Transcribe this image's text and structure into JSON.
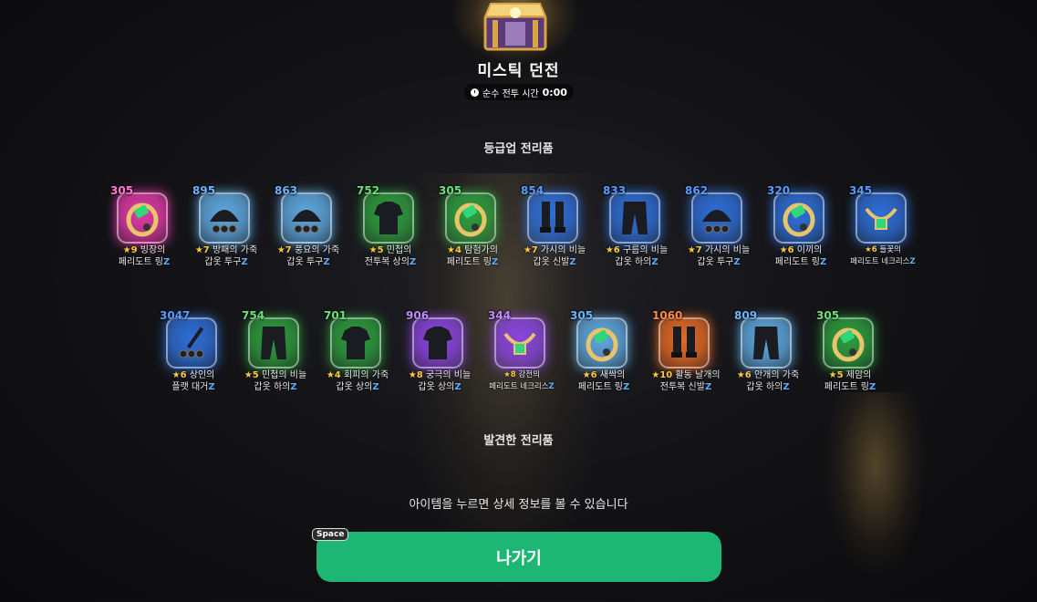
{
  "header": {
    "title": "미스틱 던전",
    "timer_label": "순수 전투 시간",
    "timer_value": "0:00"
  },
  "sections": {
    "upgrade_title": "등급업 전리품",
    "found_title": "발견한 전리품"
  },
  "items": [
    {
      "score": "305",
      "star": "★9",
      "name1": "빙장의",
      "name2": "페리도트 링",
      "icon": "ring-icon",
      "rarity": "pink",
      "z": "Z"
    },
    {
      "score": "895",
      "star": "★7",
      "name1": "방패의 가죽",
      "name2": "갑옷 투구",
      "icon": "helmet-icon",
      "rarity": "lightblue",
      "z": "Z"
    },
    {
      "score": "863",
      "star": "★7",
      "name1": "풍요의 가죽",
      "name2": "갑옷 투구",
      "icon": "helmet-icon",
      "rarity": "lightblue",
      "z": "Z"
    },
    {
      "score": "752",
      "star": "★5",
      "name1": "민첩의",
      "name2": "전투복 상의",
      "icon": "shirt-icon",
      "rarity": "green",
      "z": "Z"
    },
    {
      "score": "305",
      "star": "★4",
      "name1": "탐험가의",
      "name2": "페리도트 링",
      "icon": "ring-icon",
      "rarity": "green",
      "z": "Z"
    },
    {
      "score": "854",
      "star": "★7",
      "name1": "가시의 비늘",
      "name2": "갑옷 신발",
      "icon": "boots-icon",
      "rarity": "blue",
      "z": "Z"
    },
    {
      "score": "833",
      "star": "★6",
      "name1": "구름의 비늘",
      "name2": "갑옷 하의",
      "icon": "pants-icon",
      "rarity": "blue",
      "z": "Z"
    },
    {
      "score": "862",
      "star": "★7",
      "name1": "가시의 비늘",
      "name2": "갑옷 투구",
      "icon": "helmet-icon",
      "rarity": "blue",
      "z": "Z"
    },
    {
      "score": "320",
      "star": "★6",
      "name1": "이끼의",
      "name2": "페리도트 링",
      "icon": "ring-icon",
      "rarity": "blue",
      "z": "Z"
    },
    {
      "score": "345",
      "star": "★6",
      "name1": "들꽃의",
      "name2": "페리도트 네크리스",
      "icon": "necklace-icon",
      "rarity": "blue",
      "z": "Z"
    },
    {
      "score": "3047",
      "star": "★6",
      "name1": "상인의",
      "name2": "플랫 대거",
      "icon": "dagger-icon",
      "rarity": "blue",
      "z": "Z"
    },
    {
      "score": "754",
      "star": "★5",
      "name1": "민첩의 비늘",
      "name2": "갑옷 하의",
      "icon": "pants-icon",
      "rarity": "green",
      "z": "Z"
    },
    {
      "score": "701",
      "star": "★4",
      "name1": "회피의 가죽",
      "name2": "갑옷 상의",
      "icon": "shirt-icon",
      "rarity": "green",
      "z": "Z"
    },
    {
      "score": "906",
      "star": "★8",
      "name1": "궁극의 비늘",
      "name2": "갑옷 상의",
      "icon": "shirt-icon",
      "rarity": "purple",
      "z": "Z"
    },
    {
      "score": "344",
      "star": "★8",
      "name1": "강전의",
      "name2": "페리도트 네크리스",
      "icon": "necklace-icon",
      "rarity": "purple",
      "z": "Z"
    },
    {
      "score": "305",
      "star": "★6",
      "name1": "새싹의",
      "name2": "페리도트 링",
      "icon": "ring-icon",
      "rarity": "lightblue",
      "z": "Z"
    },
    {
      "score": "1060",
      "star": "★10",
      "name1": "활동 날개의",
      "name2": "전투복 신발",
      "icon": "boots-icon",
      "rarity": "orange",
      "z": "Z"
    },
    {
      "score": "809",
      "star": "★6",
      "name1": "안개의 가죽",
      "name2": "갑옷 하의",
      "icon": "pants-icon",
      "rarity": "lightblue",
      "z": "Z"
    },
    {
      "score": "305",
      "star": "★5",
      "name1": "제암의",
      "name2": "페리도트 링",
      "icon": "ring-icon",
      "rarity": "green",
      "z": "Z"
    }
  ],
  "footer": {
    "hint": "아이템을 누르면 상세 정보를 볼 수 있습니다",
    "key": "Space",
    "exit_label": "나가기"
  },
  "colors": {
    "pink": "#e23aa8",
    "lightblue": "#5fa9e0",
    "blue": "#2f6fd8",
    "green": "#2e9e3e",
    "purple": "#8a45e0",
    "orange": "#e36a26",
    "exit": "#1db674",
    "star": "#ffc93c"
  }
}
